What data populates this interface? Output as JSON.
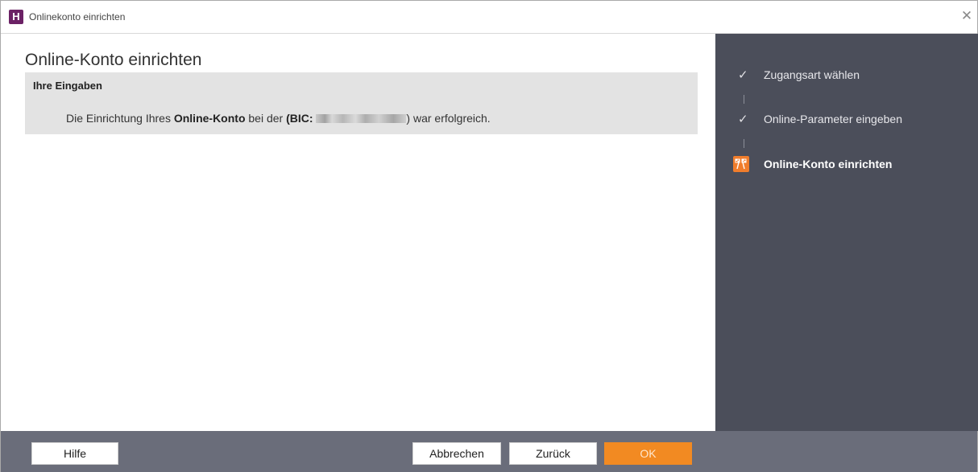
{
  "window": {
    "title": "Onlinekonto einrichten",
    "app_icon_letter": "H",
    "close_glyph": "✕"
  },
  "main": {
    "heading": "Online-Konto einrichten",
    "panel": {
      "title": "Ihre Eingaben",
      "message_prefix": "Die Einrichtung Ihres ",
      "message_bold": "Online-Konto",
      "message_middle": " bei der ",
      "message_bic_label": "(BIC: ",
      "message_suffix": ") war erfolgreich."
    }
  },
  "steps": [
    {
      "label": "Zugangsart wählen",
      "state": "done",
      "icon": "checkmark-icon"
    },
    {
      "label": "Online-Parameter eingeben",
      "state": "done",
      "icon": "checkmark-icon"
    },
    {
      "label": "Online-Konto einrichten",
      "state": "active",
      "icon": "checkered-flag-icon"
    }
  ],
  "footer": {
    "help_label": "Hilfe",
    "cancel_label": "Abbrechen",
    "back_label": "Zurück",
    "ok_label": "OK"
  },
  "colors": {
    "accent": "#f28a22",
    "sidebar_bg": "#4b4e5a",
    "footer_bg": "#6a6d7a",
    "app_icon_bg": "#6b2165"
  }
}
